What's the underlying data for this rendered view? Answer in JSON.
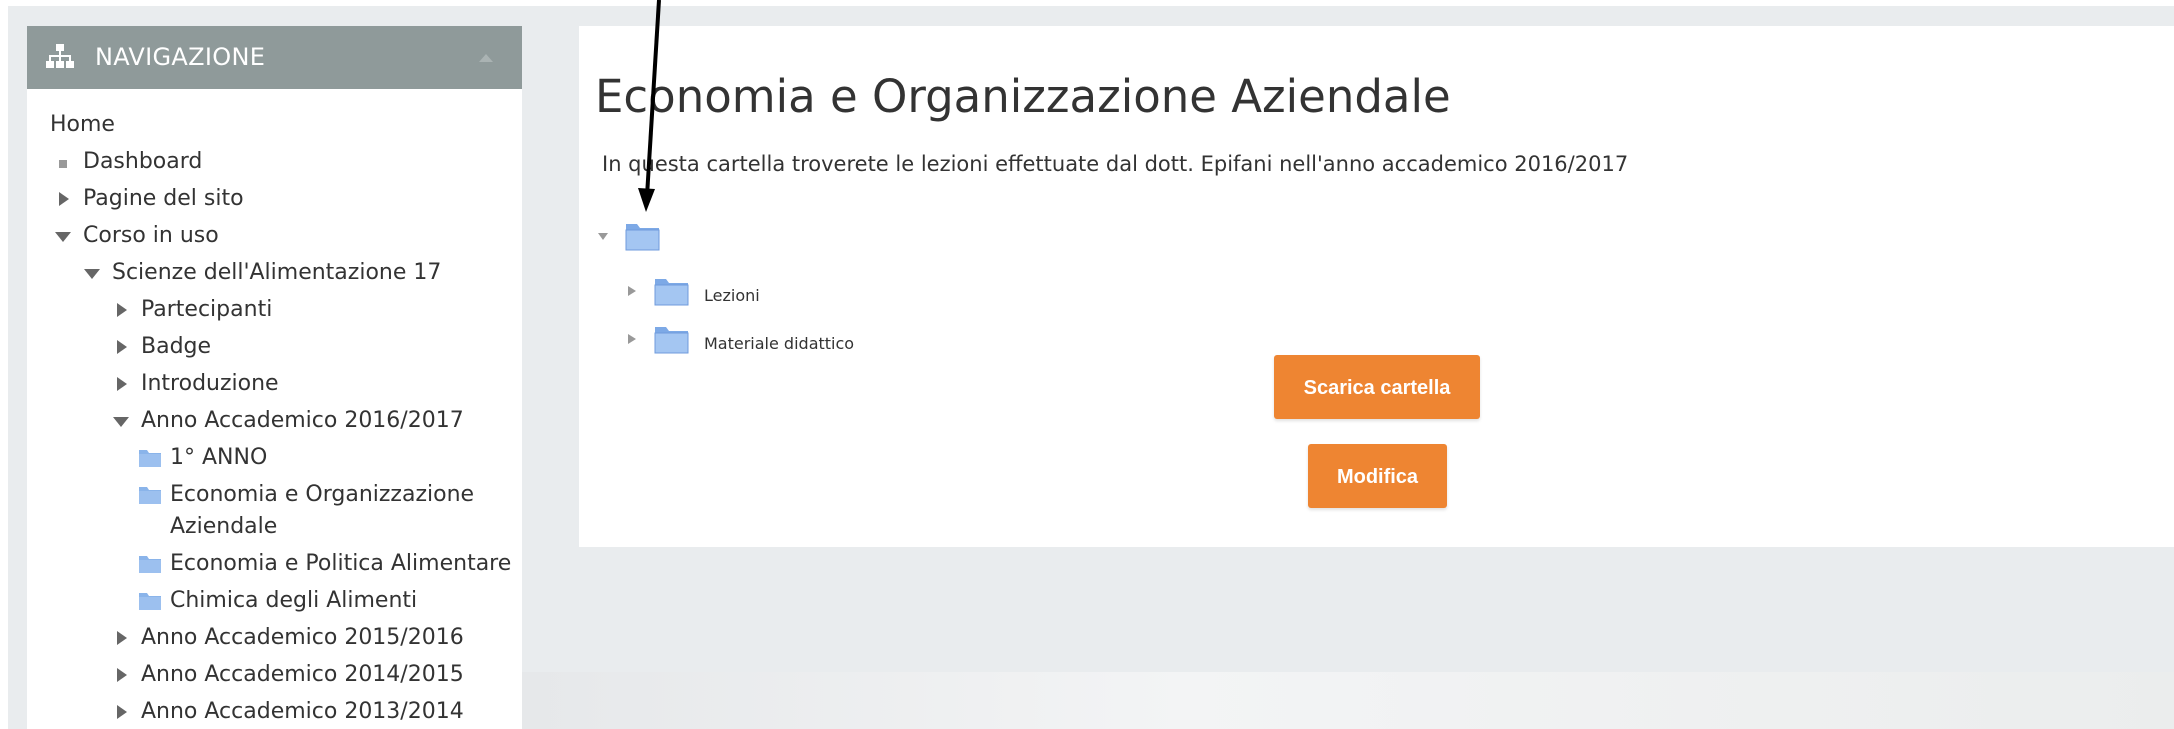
{
  "navigation": {
    "title": "NAVIGAZIONE",
    "items": [
      {
        "label": "Home"
      },
      {
        "label": "Dashboard"
      },
      {
        "label": "Pagine del sito"
      },
      {
        "label": "Corso in uso"
      },
      {
        "label": "Scienze dell'Alimentazione 17"
      },
      {
        "label": "Partecipanti"
      },
      {
        "label": "Badge"
      },
      {
        "label": "Introduzione"
      },
      {
        "label": "Anno Accademico 2016/2017"
      },
      {
        "label": "1° ANNO"
      },
      {
        "label": "Economia e Organizzazione",
        "label2": "Aziendale"
      },
      {
        "label": "Economia e Politica Alimentare"
      },
      {
        "label": "Chimica degli Alimenti"
      },
      {
        "label": "Anno Accademico 2015/2016"
      },
      {
        "label": "Anno Accademico 2014/2015"
      },
      {
        "label": "Anno Accademico 2013/2014"
      }
    ]
  },
  "main": {
    "title": "Economia e Organizzazione Aziendale",
    "description": "In questa cartella troverete le lezioni effettuate dal dott. Epifani nell'anno accademico 2016/2017",
    "folders": [
      {
        "label": "Lezioni"
      },
      {
        "label": "Materiale didattico"
      }
    ],
    "download_button": "Scarica cartella",
    "edit_button": "Modifica"
  },
  "colors": {
    "nav_header": "#8f9a9a",
    "button": "#ee8532",
    "folder": "#8ab4ea"
  }
}
